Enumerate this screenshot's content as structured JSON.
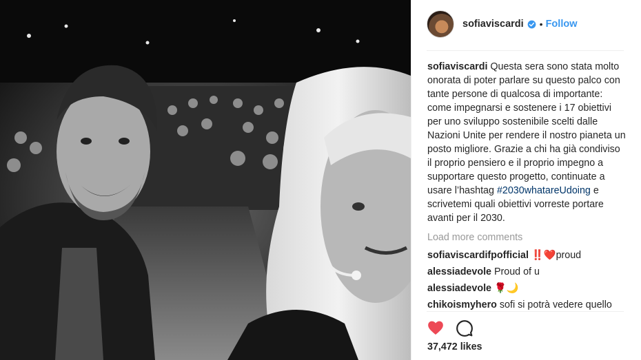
{
  "post": {
    "username": "sofiaviscardi",
    "follow_label": "Follow",
    "separator": "•",
    "caption_text": "Questa sera sono stata molto onorata di poter parlare su questo palco con tante persone di qualcosa di importante: come impegnarsi e sostenere i 17 obiettivi per uno sviluppo sostenibile scelti dalle Nazioni Unite per rendere il nostro pianeta un posto migliore. Grazie a chi ha già condiviso il proprio pensiero e il proprio impegno a supportare questo progetto, continuate a usare l’hashtag ",
    "caption_hashtag": "#2030whatareUdoing",
    "caption_tail": " e scrivetemi quali obiettivi vorreste portare avanti per il 2030.",
    "load_more": "Load more comments",
    "likes": "37,472 likes"
  },
  "comments": [
    {
      "user": "sofiaviscardifpofficial",
      "text": "‼️❤️proud"
    },
    {
      "user": "alessiadevole",
      "text": "Proud of u"
    },
    {
      "user": "alessiadevole",
      "text": "🌹🌙"
    },
    {
      "user": "chikoismyhero",
      "text": "sofi si potrà vedere quello che hai detto da qualche parte?"
    }
  ],
  "icons": {
    "verified": "verified-badge-icon",
    "like": "heart-icon",
    "comment": "comment-bubble-icon"
  },
  "colors": {
    "link_blue": "#3897f0",
    "hashtag": "#003569",
    "like_red": "#ed4956",
    "muted": "#999999"
  }
}
